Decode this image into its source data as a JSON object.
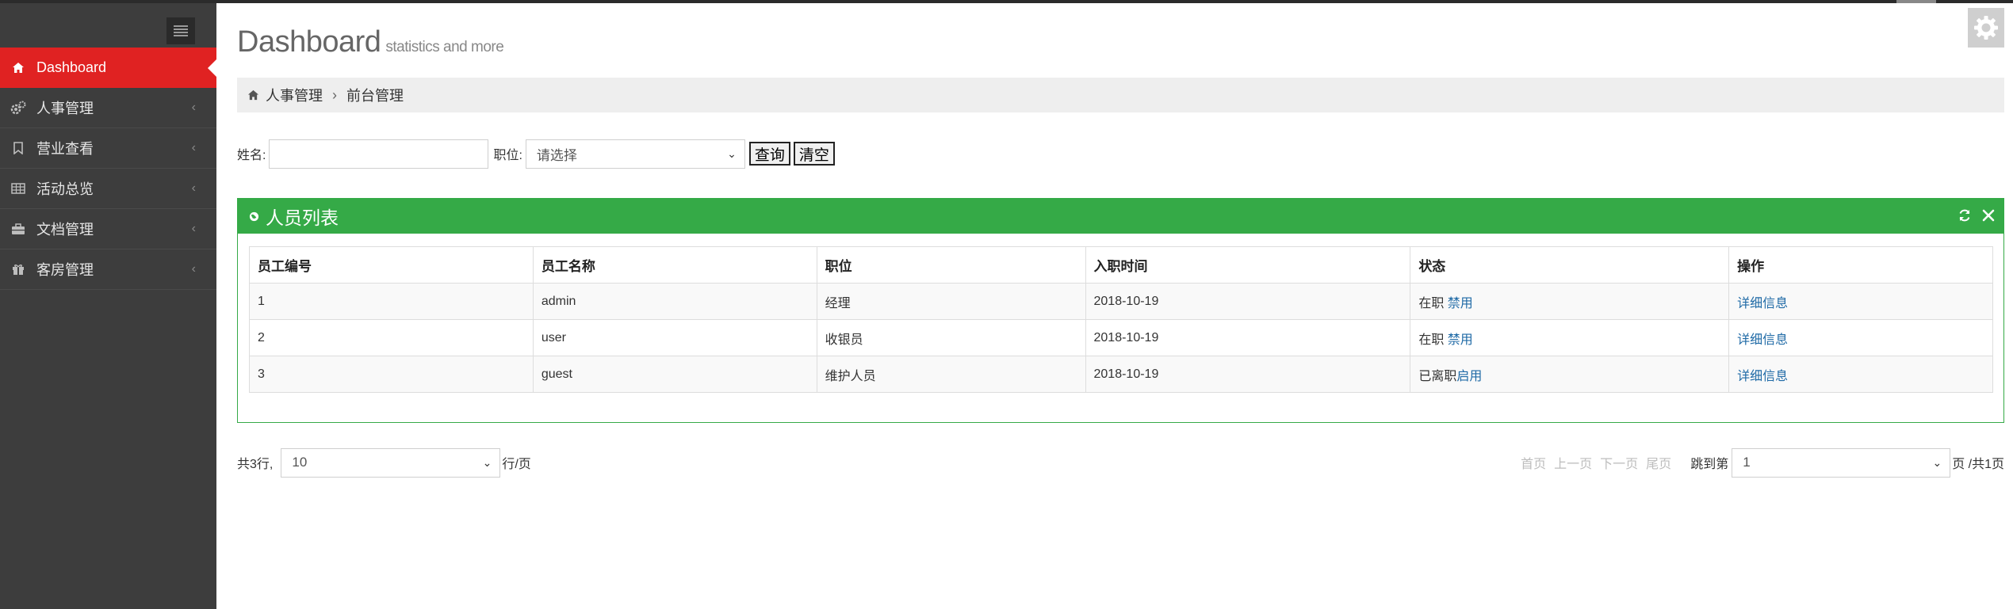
{
  "sidebar": {
    "toggle_icon": "menu-icon",
    "items": [
      {
        "label": "Dashboard",
        "icon": "home-icon",
        "active": true
      },
      {
        "label": "人事管理",
        "icon": "cogs-icon"
      },
      {
        "label": "营业查看",
        "icon": "bookmark-icon"
      },
      {
        "label": "活动总览",
        "icon": "table-icon"
      },
      {
        "label": "文档管理",
        "icon": "briefcase-icon"
      },
      {
        "label": "客房管理",
        "icon": "gift-icon"
      }
    ],
    "chevron": "‹"
  },
  "header": {
    "title": "Dashboard",
    "subtitle": "statistics and more"
  },
  "breadcrumb": {
    "home": "人事管理",
    "separator": "›",
    "current": "前台管理"
  },
  "search": {
    "name_label": "姓名:",
    "name_value": "",
    "position_label": "职位:",
    "position_placeholder": "请选择",
    "query_button": "查询",
    "clear_button": "清空"
  },
  "portlet": {
    "title": "人员列表",
    "color": "#35aa47"
  },
  "table": {
    "headers": [
      "员工编号",
      "员工名称",
      "职位",
      "入职时间",
      "状态",
      "操作"
    ],
    "rows": [
      {
        "id": "1",
        "name": "admin",
        "position": "经理",
        "hired": "2018-10-19",
        "status": "在职",
        "status_action": "禁用",
        "action": "详细信息"
      },
      {
        "id": "2",
        "name": "user",
        "position": "收银员",
        "hired": "2018-10-19",
        "status": "在职",
        "status_action": "禁用",
        "action": "详细信息"
      },
      {
        "id": "3",
        "name": "guest",
        "position": "维护人员",
        "hired": "2018-10-19",
        "status": "已离职",
        "status_action": "启用",
        "action": "详细信息"
      }
    ]
  },
  "pager": {
    "total_text": "共3行,",
    "page_size": "10",
    "per_page_text": "行/页",
    "first": "首页",
    "prev": "上一页",
    "next": "下一页",
    "last": "尾页",
    "jump_text": "跳到第",
    "current_page": "1",
    "page_suffix": "页 /共1页"
  },
  "colors": {
    "sidebar_bg": "#3d3d3d",
    "active_red": "#e02222",
    "green": "#35aa47",
    "link_blue": "#1f6aa6"
  }
}
